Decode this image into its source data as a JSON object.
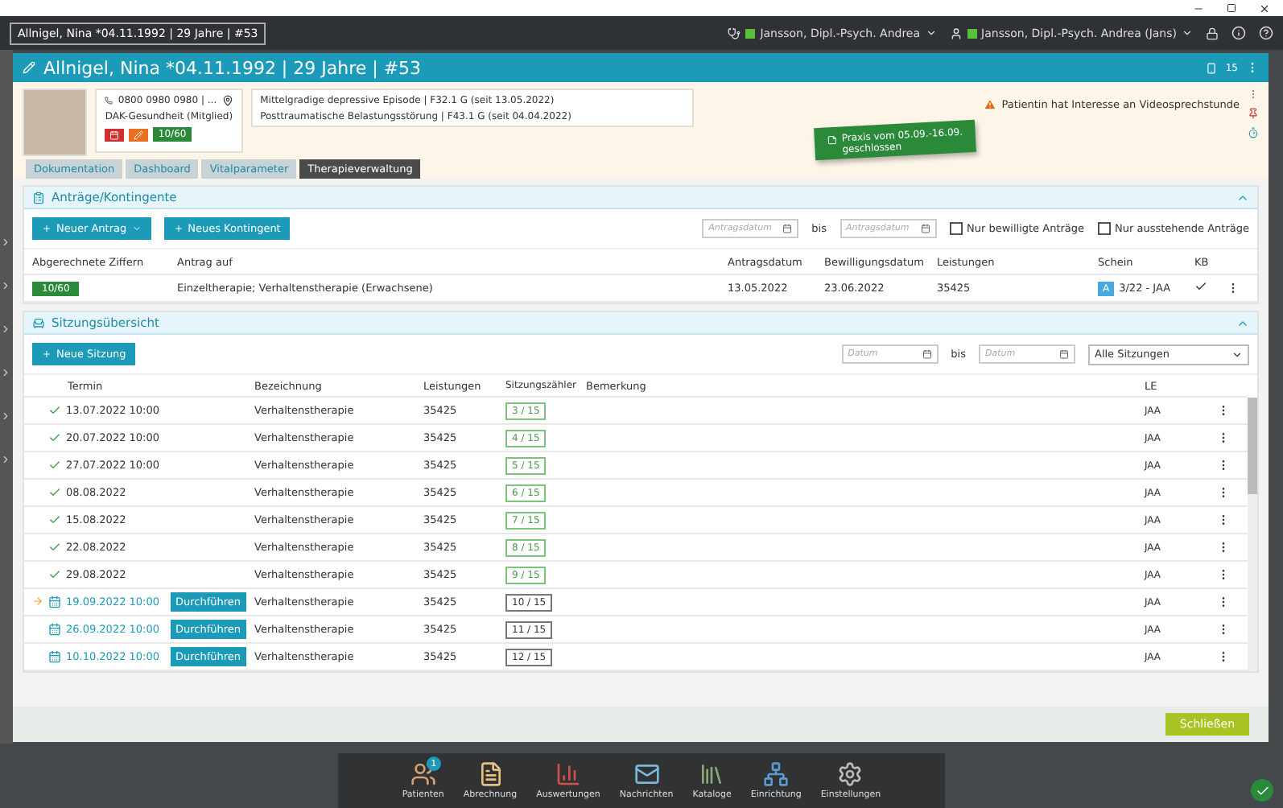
{
  "top_bar": {
    "patient_tab": "Allnigel, Nina *04.11.1992 | 29 Jahre | #53",
    "users": [
      {
        "kind": "practitioner",
        "name": "Jansson, Dipl.-Psych. Andrea"
      },
      {
        "kind": "user",
        "name": "Jansson, Dipl.-Psych. Andrea (Jans)"
      }
    ]
  },
  "patient": {
    "title": "Allnigel, Nina *04.11.1992 | 29 Jahre | #53",
    "count": "15",
    "phone": "0800 0980 0980 | ...",
    "insurance": "DAK-Gesundheit (Mitglied)",
    "quota": "10/60",
    "diagnoses": [
      "Mittelgradige depressive Episode | F32.1 G (seit 13.05.2022)",
      "Posttraumatische Belastungsstörung | F43.1 G (seit 04.04.2022)"
    ],
    "note": [
      "Praxis vom 05.09.-16.09.",
      "geschlossen"
    ],
    "alert": "Patientin hat Interesse an Videosprechstunde"
  },
  "tabs": [
    {
      "label": "Dokumentation",
      "selected": false
    },
    {
      "label": "Dashboard",
      "selected": false
    },
    {
      "label": "Vitalparameter",
      "selected": false
    },
    {
      "label": "Therapieverwaltung",
      "selected": true
    }
  ],
  "applications": {
    "title": "Anträge/Kontingente",
    "expanded": true,
    "new_button": "Neuer Antrag",
    "quota_button": "Neues Kontingent",
    "from_placeholder": "Antragsdatum",
    "between": "bis",
    "to_placeholder": "Antragsdatum",
    "filters": [
      {
        "label": "Nur bewilligte Anträge",
        "checked": false
      },
      {
        "label": "Nur ausstehende Anträge",
        "checked": false
      }
    ],
    "columns": [
      "Abgerechnete Ziffern",
      "Antrag auf",
      "Antragsdatum",
      "Bewilligungsdatum",
      "Leistungen",
      "Schein",
      "KB"
    ],
    "rows": [
      {
        "billed": "10/60",
        "type": "Einzeltherapie; Verhaltenstherapie (Erwachsene)",
        "date": "13.05.2022",
        "approved": "23.06.2022",
        "service": "35425",
        "voucher_badge": "A",
        "voucher": "3/22 - JAA",
        "kb": true
      }
    ]
  },
  "sessions": {
    "title": "Sitzungsübersicht",
    "expanded": true,
    "new_button": "Neue Sitzung",
    "from_placeholder": "Datum",
    "between": "bis",
    "to_placeholder": "Datum",
    "filter": "Alle Sitzungen",
    "columns": [
      "Termin",
      "Bezeichnung",
      "Leistungen",
      "Sitzungszähler",
      "Bemerkung",
      "LE"
    ],
    "rows": [
      {
        "kind": "done",
        "current": false,
        "date": "13.07.2022 10:00",
        "name": "Verhaltenstherapie",
        "service": "35425",
        "counter": "3 / 15",
        "le": "JAA"
      },
      {
        "kind": "done",
        "current": false,
        "date": "20.07.2022 10:00",
        "name": "Verhaltenstherapie",
        "service": "35425",
        "counter": "4 / 15",
        "le": "JAA"
      },
      {
        "kind": "done",
        "current": false,
        "date": "27.07.2022 10:00",
        "name": "Verhaltenstherapie",
        "service": "35425",
        "counter": "5 / 15",
        "le": "JAA"
      },
      {
        "kind": "done",
        "current": false,
        "date": "08.08.2022",
        "name": "Verhaltenstherapie",
        "service": "35425",
        "counter": "6 / 15",
        "le": "JAA"
      },
      {
        "kind": "done",
        "current": false,
        "date": "15.08.2022",
        "name": "Verhaltenstherapie",
        "service": "35425",
        "counter": "7 / 15",
        "le": "JAA"
      },
      {
        "kind": "done",
        "current": false,
        "date": "22.08.2022",
        "name": "Verhaltenstherapie",
        "service": "35425",
        "counter": "8 / 15",
        "le": "JAA"
      },
      {
        "kind": "done",
        "current": false,
        "date": "29.08.2022",
        "name": "Verhaltenstherapie",
        "service": "35425",
        "counter": "9 / 15",
        "le": "JAA"
      },
      {
        "kind": "planned",
        "current": true,
        "date": "19.09.2022 10:00",
        "action": "Durchführen",
        "name": "Verhaltenstherapie",
        "service": "35425",
        "counter": "10 / 15",
        "le": "JAA"
      },
      {
        "kind": "planned",
        "current": false,
        "date": "26.09.2022 10:00",
        "action": "Durchführen",
        "name": "Verhaltenstherapie",
        "service": "35425",
        "counter": "11 / 15",
        "le": "JAA"
      },
      {
        "kind": "planned",
        "current": false,
        "date": "10.10.2022 10:00",
        "action": "Durchführen",
        "name": "Verhaltenstherapie",
        "service": "35425",
        "counter": "12 / 15",
        "le": "JAA"
      }
    ]
  },
  "footer": {
    "close_button": "Schließen"
  },
  "dock": [
    {
      "kind": "patients",
      "label": "Patienten",
      "badge": "1"
    },
    {
      "kind": "billing",
      "label": "Abrechnung"
    },
    {
      "kind": "stats",
      "label": "Auswertungen"
    },
    {
      "kind": "messages",
      "label": "Nachrichten"
    },
    {
      "kind": "catalogs",
      "label": "Kataloge"
    },
    {
      "kind": "setup",
      "label": "Einrichtung"
    },
    {
      "kind": "settings",
      "label": "Einstellungen"
    }
  ]
}
